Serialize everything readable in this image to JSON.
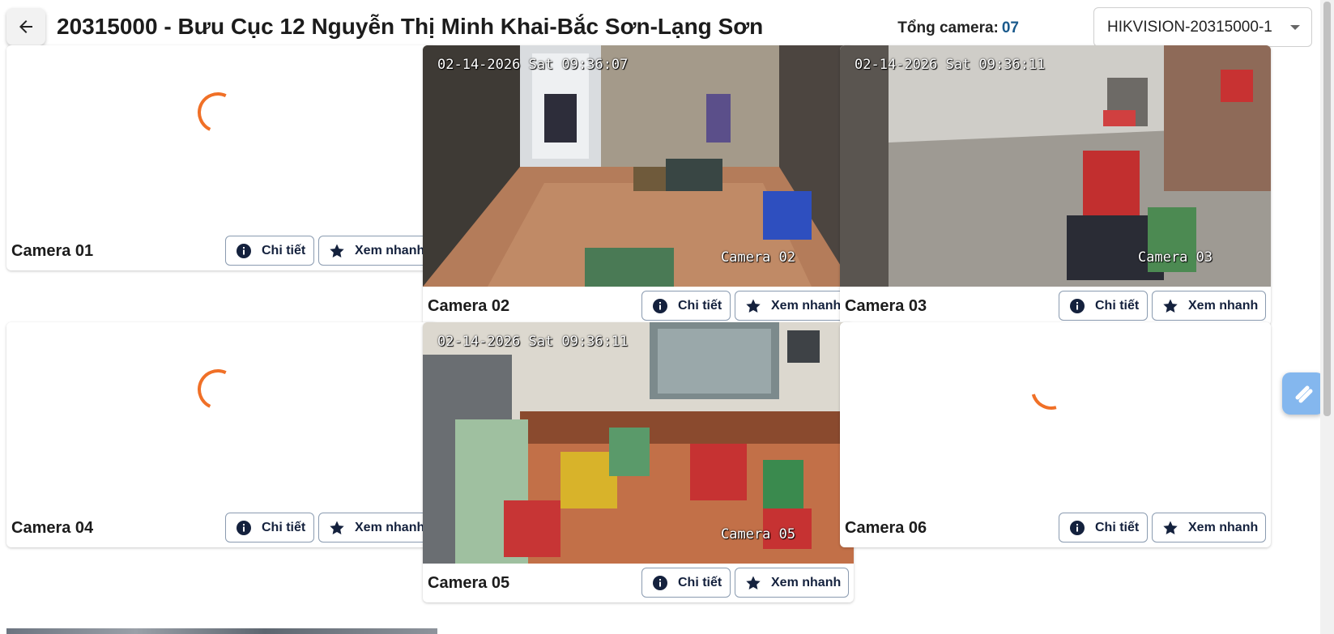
{
  "header": {
    "title": "20315000 - Bưu Cục 12 Nguyễn Thị Minh Khai-Bắc Sơn-Lạng Sơn",
    "total_label": "Tổng camera:",
    "total_value": "07",
    "device_selected": "HIKVISION-20315000-1"
  },
  "buttons": {
    "detail": "Chi tiết",
    "quick_view": "Xem nhanh"
  },
  "cameras": [
    {
      "label": "Camera 01",
      "state": "loading"
    },
    {
      "label": "Camera 02",
      "state": "live",
      "timestamp": "02-14-2026 Sat 09:36:07",
      "overlay_name": "Camera 02"
    },
    {
      "label": "Camera 03",
      "state": "live",
      "timestamp": "02-14-2026 Sat 09:36:11",
      "overlay_name": "Camera 03"
    },
    {
      "label": "Camera 04",
      "state": "loading"
    },
    {
      "label": "Camera 05",
      "state": "live",
      "timestamp": "02-14-2026 Sat 09:36:11",
      "overlay_name": "Camera 05"
    },
    {
      "label": "Camera 06",
      "state": "loading"
    }
  ],
  "colors": {
    "accent_number": "#1a5a8c",
    "spinner": "#f07027",
    "button_text": "#14213d"
  }
}
